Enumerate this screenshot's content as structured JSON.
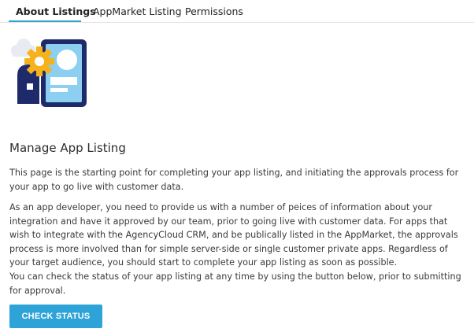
{
  "tabs": [
    {
      "label": "About Listings",
      "active": true
    },
    {
      "label": "AppMarket Listing",
      "active": false
    },
    {
      "label": "Permissions",
      "active": false
    }
  ],
  "colors": {
    "accent": "#2ea3d8",
    "text": "#3a3a3a",
    "heading": "#2d2d2d",
    "illustration_navy": "#1f2a6b",
    "illustration_light_blue": "#8ccff0",
    "illustration_gear": "#f5b21b"
  },
  "illustration_icon": "app-developer-illustration",
  "main": {
    "heading": "Manage App Listing",
    "paragraphs": [
      "This page is the starting point for completing your app listing, and initiating the approvals process for your app to go live with customer data.",
      "As an app developer, you need to provide us with a number of peices of information about your integration and have it approved by our team, prior to going live with customer data. For apps that wish to integrate with the AgencyCloud CRM, and be publically listed in the AppMarket, the approvals process is more involved than for simple server-side or single customer private apps. Regardless of your target audience, you should start to complete your app listing as soon as possible.",
      "You can check the status of your app listing at any time by using the button below, prior to submitting for approval."
    ],
    "check_status_label": "CHECK STATUS"
  }
}
